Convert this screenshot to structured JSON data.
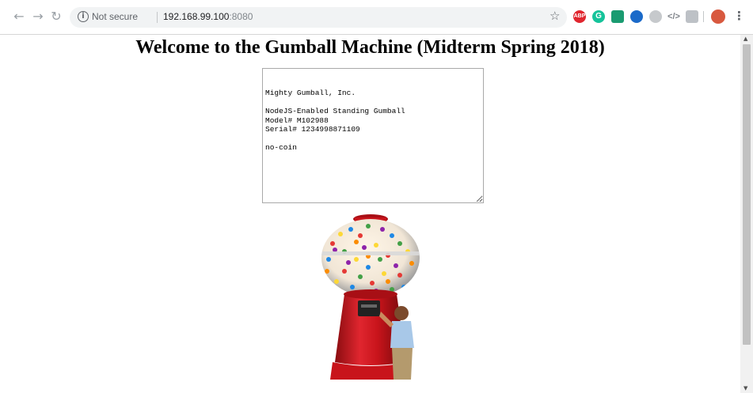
{
  "browser": {
    "security_label": "Not secure",
    "url_host": "192.168.99.100",
    "url_port": ":8080",
    "extensions": [
      {
        "name": "adblock-extension-icon",
        "label": "ABP",
        "color": "#e0262f"
      },
      {
        "name": "grammarly-extension-icon",
        "label": "G",
        "color": "#15c39a"
      },
      {
        "name": "translate-extension-icon",
        "label": "",
        "color": "#1a9b71"
      },
      {
        "name": "blue-extension-icon",
        "label": "",
        "color": "#1b6ac9"
      },
      {
        "name": "gray-extension-icon",
        "label": "",
        "color": "#c6c9cc"
      },
      {
        "name": "code-extension-icon",
        "label": "",
        "color": "#7d8187"
      },
      {
        "name": "square-extension-icon",
        "label": "",
        "color": "#bdc1c6"
      },
      {
        "name": "profile-avatar-icon",
        "label": "",
        "color": "#d8593f"
      }
    ]
  },
  "page": {
    "title": "Welcome to the Gumball Machine (Midterm Spring 2018)",
    "status_text": "Mighty Gumball, Inc.\n\nNodeJS-Enabled Standing Gumball\nModel# M102988\nSerial# 1234998871109\n\nno-coin"
  },
  "colors": {
    "machine_red": "#c8141b",
    "machine_dark_red": "#8a0c10"
  }
}
